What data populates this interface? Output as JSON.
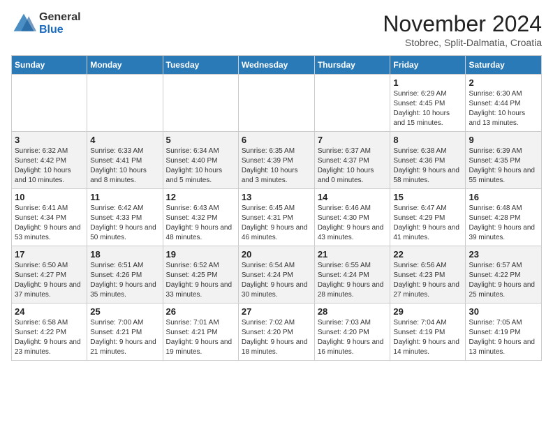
{
  "logo": {
    "general": "General",
    "blue": "Blue"
  },
  "header": {
    "month": "November 2024",
    "location": "Stobrec, Split-Dalmatia, Croatia"
  },
  "weekdays": [
    "Sunday",
    "Monday",
    "Tuesday",
    "Wednesday",
    "Thursday",
    "Friday",
    "Saturday"
  ],
  "weeks": [
    [
      {
        "day": "",
        "info": ""
      },
      {
        "day": "",
        "info": ""
      },
      {
        "day": "",
        "info": ""
      },
      {
        "day": "",
        "info": ""
      },
      {
        "day": "",
        "info": ""
      },
      {
        "day": "1",
        "info": "Sunrise: 6:29 AM\nSunset: 4:45 PM\nDaylight: 10 hours and 15 minutes."
      },
      {
        "day": "2",
        "info": "Sunrise: 6:30 AM\nSunset: 4:44 PM\nDaylight: 10 hours and 13 minutes."
      }
    ],
    [
      {
        "day": "3",
        "info": "Sunrise: 6:32 AM\nSunset: 4:42 PM\nDaylight: 10 hours and 10 minutes."
      },
      {
        "day": "4",
        "info": "Sunrise: 6:33 AM\nSunset: 4:41 PM\nDaylight: 10 hours and 8 minutes."
      },
      {
        "day": "5",
        "info": "Sunrise: 6:34 AM\nSunset: 4:40 PM\nDaylight: 10 hours and 5 minutes."
      },
      {
        "day": "6",
        "info": "Sunrise: 6:35 AM\nSunset: 4:39 PM\nDaylight: 10 hours and 3 minutes."
      },
      {
        "day": "7",
        "info": "Sunrise: 6:37 AM\nSunset: 4:37 PM\nDaylight: 10 hours and 0 minutes."
      },
      {
        "day": "8",
        "info": "Sunrise: 6:38 AM\nSunset: 4:36 PM\nDaylight: 9 hours and 58 minutes."
      },
      {
        "day": "9",
        "info": "Sunrise: 6:39 AM\nSunset: 4:35 PM\nDaylight: 9 hours and 55 minutes."
      }
    ],
    [
      {
        "day": "10",
        "info": "Sunrise: 6:41 AM\nSunset: 4:34 PM\nDaylight: 9 hours and 53 minutes."
      },
      {
        "day": "11",
        "info": "Sunrise: 6:42 AM\nSunset: 4:33 PM\nDaylight: 9 hours and 50 minutes."
      },
      {
        "day": "12",
        "info": "Sunrise: 6:43 AM\nSunset: 4:32 PM\nDaylight: 9 hours and 48 minutes."
      },
      {
        "day": "13",
        "info": "Sunrise: 6:45 AM\nSunset: 4:31 PM\nDaylight: 9 hours and 46 minutes."
      },
      {
        "day": "14",
        "info": "Sunrise: 6:46 AM\nSunset: 4:30 PM\nDaylight: 9 hours and 43 minutes."
      },
      {
        "day": "15",
        "info": "Sunrise: 6:47 AM\nSunset: 4:29 PM\nDaylight: 9 hours and 41 minutes."
      },
      {
        "day": "16",
        "info": "Sunrise: 6:48 AM\nSunset: 4:28 PM\nDaylight: 9 hours and 39 minutes."
      }
    ],
    [
      {
        "day": "17",
        "info": "Sunrise: 6:50 AM\nSunset: 4:27 PM\nDaylight: 9 hours and 37 minutes."
      },
      {
        "day": "18",
        "info": "Sunrise: 6:51 AM\nSunset: 4:26 PM\nDaylight: 9 hours and 35 minutes."
      },
      {
        "day": "19",
        "info": "Sunrise: 6:52 AM\nSunset: 4:25 PM\nDaylight: 9 hours and 33 minutes."
      },
      {
        "day": "20",
        "info": "Sunrise: 6:54 AM\nSunset: 4:24 PM\nDaylight: 9 hours and 30 minutes."
      },
      {
        "day": "21",
        "info": "Sunrise: 6:55 AM\nSunset: 4:24 PM\nDaylight: 9 hours and 28 minutes."
      },
      {
        "day": "22",
        "info": "Sunrise: 6:56 AM\nSunset: 4:23 PM\nDaylight: 9 hours and 27 minutes."
      },
      {
        "day": "23",
        "info": "Sunrise: 6:57 AM\nSunset: 4:22 PM\nDaylight: 9 hours and 25 minutes."
      }
    ],
    [
      {
        "day": "24",
        "info": "Sunrise: 6:58 AM\nSunset: 4:22 PM\nDaylight: 9 hours and 23 minutes."
      },
      {
        "day": "25",
        "info": "Sunrise: 7:00 AM\nSunset: 4:21 PM\nDaylight: 9 hours and 21 minutes."
      },
      {
        "day": "26",
        "info": "Sunrise: 7:01 AM\nSunset: 4:21 PM\nDaylight: 9 hours and 19 minutes."
      },
      {
        "day": "27",
        "info": "Sunrise: 7:02 AM\nSunset: 4:20 PM\nDaylight: 9 hours and 18 minutes."
      },
      {
        "day": "28",
        "info": "Sunrise: 7:03 AM\nSunset: 4:20 PM\nDaylight: 9 hours and 16 minutes."
      },
      {
        "day": "29",
        "info": "Sunrise: 7:04 AM\nSunset: 4:19 PM\nDaylight: 9 hours and 14 minutes."
      },
      {
        "day": "30",
        "info": "Sunrise: 7:05 AM\nSunset: 4:19 PM\nDaylight: 9 hours and 13 minutes."
      }
    ]
  ]
}
